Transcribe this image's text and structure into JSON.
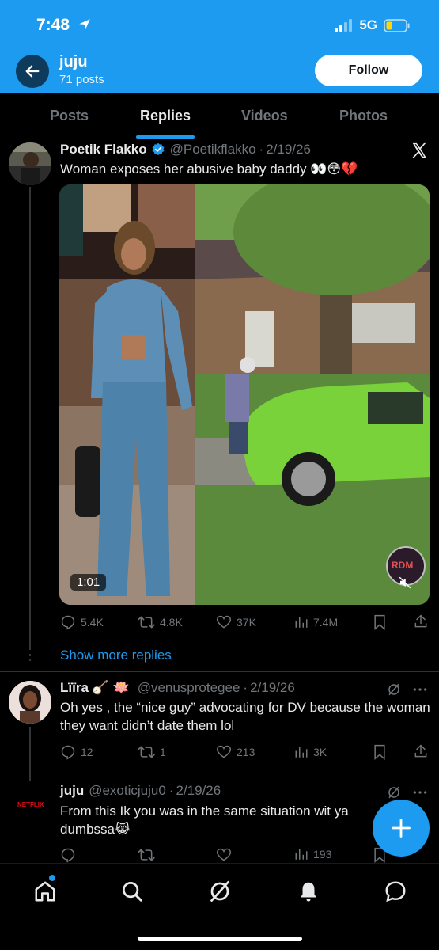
{
  "status_bar": {
    "time": "7:48",
    "network": "5G"
  },
  "header": {
    "account_name": "juju",
    "post_count": "71 posts",
    "follow_label": "Follow"
  },
  "tabs": [
    {
      "label": "Posts",
      "active": false
    },
    {
      "label": "Replies",
      "active": true
    },
    {
      "label": "Videos",
      "active": false
    },
    {
      "label": "Photos",
      "active": false
    }
  ],
  "posts": [
    {
      "name": "Poetik Flakko",
      "verified": true,
      "handle": "@Poetikflakko",
      "date": "2/19/26",
      "text": "Woman exposes her abusive baby daddy 👀😳💔",
      "media": {
        "duration": "1:01",
        "badge": "RDM"
      },
      "stats": {
        "replies": "5.4K",
        "reposts": "4.8K",
        "likes": "37K",
        "views": "7.4M"
      }
    },
    {
      "name": "Lïïra 🪕 🪷",
      "handle": "@venusprotegee",
      "date": "2/19/26",
      "text": "Oh yes , the “nice guy” advocating for DV because the woman they want didn’t date them lol",
      "stats": {
        "replies": "12",
        "reposts": "1",
        "likes": "213",
        "views": "3K"
      }
    },
    {
      "name": "juju",
      "handle": "@exoticjuju0",
      "date": "2/19/26",
      "text_line1": "From this Ik you was in the same situation wit ya",
      "text_line2": "dumbssa😹",
      "avatar_text": "NETFLIX",
      "stats": {
        "views": "193"
      }
    }
  ],
  "show_more": "Show more replies",
  "colors": {
    "accent": "#1d9bf0",
    "background": "#000000",
    "muted": "#71767b"
  }
}
